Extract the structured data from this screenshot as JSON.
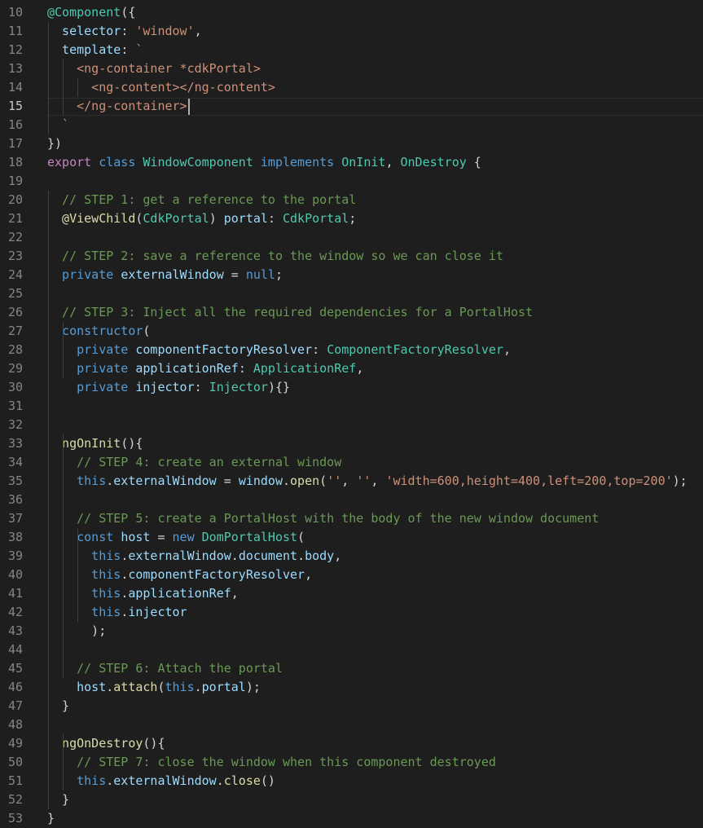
{
  "editor": {
    "colors": {
      "background": "#1e1e1e",
      "line_number": "#858585",
      "line_number_active": "#c6c6c6",
      "indent_guide": "#404040",
      "cursor": "#aeafad"
    },
    "active_line": 15,
    "lines": [
      {
        "n": 10,
        "tokens": [
          [
            "@Component",
            "#4ec9b0"
          ],
          [
            "({",
            "#d4d4d4"
          ]
        ]
      },
      {
        "n": 11,
        "tokens": [
          [
            "  selector",
            "#9cdcfe"
          ],
          [
            ": ",
            "#d4d4d4"
          ],
          [
            "'window'",
            "#ce9178"
          ],
          [
            ",",
            "#d4d4d4"
          ]
        ]
      },
      {
        "n": 12,
        "tokens": [
          [
            "  template",
            "#9cdcfe"
          ],
          [
            ": ",
            "#d4d4d4"
          ],
          [
            "`",
            "#ce9178"
          ]
        ]
      },
      {
        "n": 13,
        "tokens": [
          [
            "    <ng-container *cdkPortal>",
            "#ce9178"
          ]
        ]
      },
      {
        "n": 14,
        "tokens": [
          [
            "      <ng-content></ng-content>",
            "#ce9178"
          ]
        ]
      },
      {
        "n": 15,
        "tokens": [
          [
            "    </ng-container>",
            "#ce9178"
          ]
        ]
      },
      {
        "n": 16,
        "tokens": [
          [
            "  `",
            "#ce9178"
          ]
        ]
      },
      {
        "n": 17,
        "tokens": [
          [
            "})",
            "#d4d4d4"
          ]
        ]
      },
      {
        "n": 18,
        "tokens": [
          [
            "export",
            "#c586c0"
          ],
          [
            " ",
            "#d4d4d4"
          ],
          [
            "class",
            "#569cd6"
          ],
          [
            " ",
            "#d4d4d4"
          ],
          [
            "WindowComponent",
            "#4ec9b0"
          ],
          [
            " ",
            "#d4d4d4"
          ],
          [
            "implements",
            "#569cd6"
          ],
          [
            " ",
            "#d4d4d4"
          ],
          [
            "OnInit",
            "#4ec9b0"
          ],
          [
            ", ",
            "#d4d4d4"
          ],
          [
            "OnDestroy",
            "#4ec9b0"
          ],
          [
            " {",
            "#d4d4d4"
          ]
        ]
      },
      {
        "n": 19,
        "tokens": []
      },
      {
        "n": 20,
        "tokens": [
          [
            "  // STEP 1: get a reference to the portal",
            "#6a9955"
          ]
        ]
      },
      {
        "n": 21,
        "tokens": [
          [
            "  @ViewChild",
            "#dcdcaa"
          ],
          [
            "(",
            "#d4d4d4"
          ],
          [
            "CdkPortal",
            "#4ec9b0"
          ],
          [
            ") ",
            "#d4d4d4"
          ],
          [
            "portal",
            "#9cdcfe"
          ],
          [
            ": ",
            "#d4d4d4"
          ],
          [
            "CdkPortal",
            "#4ec9b0"
          ],
          [
            ";",
            "#d4d4d4"
          ]
        ]
      },
      {
        "n": 22,
        "tokens": []
      },
      {
        "n": 23,
        "tokens": [
          [
            "  // STEP 2: save a reference to the window so we can close it",
            "#6a9955"
          ]
        ]
      },
      {
        "n": 24,
        "tokens": [
          [
            "  private",
            "#569cd6"
          ],
          [
            " ",
            "#d4d4d4"
          ],
          [
            "externalWindow",
            "#9cdcfe"
          ],
          [
            " = ",
            "#d4d4d4"
          ],
          [
            "null",
            "#569cd6"
          ],
          [
            ";",
            "#d4d4d4"
          ]
        ]
      },
      {
        "n": 25,
        "tokens": []
      },
      {
        "n": 26,
        "tokens": [
          [
            "  // STEP 3: Inject all the required dependencies for a PortalHost",
            "#6a9955"
          ]
        ]
      },
      {
        "n": 27,
        "tokens": [
          [
            "  constructor",
            "#569cd6"
          ],
          [
            "(",
            "#d4d4d4"
          ]
        ]
      },
      {
        "n": 28,
        "tokens": [
          [
            "    private",
            "#569cd6"
          ],
          [
            " ",
            "#d4d4d4"
          ],
          [
            "componentFactoryResolver",
            "#9cdcfe"
          ],
          [
            ": ",
            "#d4d4d4"
          ],
          [
            "ComponentFactoryResolver",
            "#4ec9b0"
          ],
          [
            ",",
            "#d4d4d4"
          ]
        ]
      },
      {
        "n": 29,
        "tokens": [
          [
            "    private",
            "#569cd6"
          ],
          [
            " ",
            "#d4d4d4"
          ],
          [
            "applicationRef",
            "#9cdcfe"
          ],
          [
            ": ",
            "#d4d4d4"
          ],
          [
            "ApplicationRef",
            "#4ec9b0"
          ],
          [
            ",",
            "#d4d4d4"
          ]
        ]
      },
      {
        "n": 30,
        "tokens": [
          [
            "    private",
            "#569cd6"
          ],
          [
            " ",
            "#d4d4d4"
          ],
          [
            "injector",
            "#9cdcfe"
          ],
          [
            ": ",
            "#d4d4d4"
          ],
          [
            "Injector",
            "#4ec9b0"
          ],
          [
            "){}",
            "#d4d4d4"
          ]
        ]
      },
      {
        "n": 31,
        "tokens": []
      },
      {
        "n": 32,
        "tokens": []
      },
      {
        "n": 33,
        "tokens": [
          [
            "  ngOnInit",
            "#dcdcaa"
          ],
          [
            "(){",
            "#d4d4d4"
          ]
        ]
      },
      {
        "n": 34,
        "tokens": [
          [
            "    // STEP 4: create an external window",
            "#6a9955"
          ]
        ]
      },
      {
        "n": 35,
        "tokens": [
          [
            "    this",
            "#569cd6"
          ],
          [
            ".",
            "#d4d4d4"
          ],
          [
            "externalWindow",
            "#9cdcfe"
          ],
          [
            " = ",
            "#d4d4d4"
          ],
          [
            "window",
            "#9cdcfe"
          ],
          [
            ".",
            "#d4d4d4"
          ],
          [
            "open",
            "#dcdcaa"
          ],
          [
            "(",
            "#d4d4d4"
          ],
          [
            "''",
            "#ce9178"
          ],
          [
            ", ",
            "#d4d4d4"
          ],
          [
            "''",
            "#ce9178"
          ],
          [
            ", ",
            "#d4d4d4"
          ],
          [
            "'width=600,height=400,left=200,top=200'",
            "#ce9178"
          ],
          [
            ");",
            "#d4d4d4"
          ]
        ]
      },
      {
        "n": 36,
        "tokens": []
      },
      {
        "n": 37,
        "tokens": [
          [
            "    // STEP 5: create a PortalHost with the body of the new window document",
            "#6a9955"
          ]
        ]
      },
      {
        "n": 38,
        "tokens": [
          [
            "    const",
            "#569cd6"
          ],
          [
            " ",
            "#d4d4d4"
          ],
          [
            "host",
            "#9cdcfe"
          ],
          [
            " = ",
            "#d4d4d4"
          ],
          [
            "new",
            "#569cd6"
          ],
          [
            " ",
            "#d4d4d4"
          ],
          [
            "DomPortalHost",
            "#4ec9b0"
          ],
          [
            "(",
            "#d4d4d4"
          ]
        ]
      },
      {
        "n": 39,
        "tokens": [
          [
            "      this",
            "#569cd6"
          ],
          [
            ".",
            "#d4d4d4"
          ],
          [
            "externalWindow",
            "#9cdcfe"
          ],
          [
            ".",
            "#d4d4d4"
          ],
          [
            "document",
            "#9cdcfe"
          ],
          [
            ".",
            "#d4d4d4"
          ],
          [
            "body",
            "#9cdcfe"
          ],
          [
            ",",
            "#d4d4d4"
          ]
        ]
      },
      {
        "n": 40,
        "tokens": [
          [
            "      this",
            "#569cd6"
          ],
          [
            ".",
            "#d4d4d4"
          ],
          [
            "componentFactoryResolver",
            "#9cdcfe"
          ],
          [
            ",",
            "#d4d4d4"
          ]
        ]
      },
      {
        "n": 41,
        "tokens": [
          [
            "      this",
            "#569cd6"
          ],
          [
            ".",
            "#d4d4d4"
          ],
          [
            "applicationRef",
            "#9cdcfe"
          ],
          [
            ",",
            "#d4d4d4"
          ]
        ]
      },
      {
        "n": 42,
        "tokens": [
          [
            "      this",
            "#569cd6"
          ],
          [
            ".",
            "#d4d4d4"
          ],
          [
            "injector",
            "#9cdcfe"
          ]
        ]
      },
      {
        "n": 43,
        "tokens": [
          [
            "      );",
            "#d4d4d4"
          ]
        ]
      },
      {
        "n": 44,
        "tokens": []
      },
      {
        "n": 45,
        "tokens": [
          [
            "    // STEP 6: Attach the portal",
            "#6a9955"
          ]
        ]
      },
      {
        "n": 46,
        "tokens": [
          [
            "    host",
            "#9cdcfe"
          ],
          [
            ".",
            "#d4d4d4"
          ],
          [
            "attach",
            "#dcdcaa"
          ],
          [
            "(",
            "#d4d4d4"
          ],
          [
            "this",
            "#569cd6"
          ],
          [
            ".",
            "#d4d4d4"
          ],
          [
            "portal",
            "#9cdcfe"
          ],
          [
            ");",
            "#d4d4d4"
          ]
        ]
      },
      {
        "n": 47,
        "tokens": [
          [
            "  }",
            "#d4d4d4"
          ]
        ]
      },
      {
        "n": 48,
        "tokens": []
      },
      {
        "n": 49,
        "tokens": [
          [
            "  ngOnDestroy",
            "#dcdcaa"
          ],
          [
            "(){",
            "#d4d4d4"
          ]
        ]
      },
      {
        "n": 50,
        "tokens": [
          [
            "    // STEP 7: close the window when this component destroyed",
            "#6a9955"
          ]
        ]
      },
      {
        "n": 51,
        "tokens": [
          [
            "    this",
            "#569cd6"
          ],
          [
            ".",
            "#d4d4d4"
          ],
          [
            "externalWindow",
            "#9cdcfe"
          ],
          [
            ".",
            "#d4d4d4"
          ],
          [
            "close",
            "#dcdcaa"
          ],
          [
            "()",
            "#d4d4d4"
          ]
        ]
      },
      {
        "n": 52,
        "tokens": [
          [
            "  }",
            "#d4d4d4"
          ]
        ]
      },
      {
        "n": 53,
        "tokens": [
          [
            "}",
            "#d4d4d4"
          ]
        ]
      }
    ]
  }
}
